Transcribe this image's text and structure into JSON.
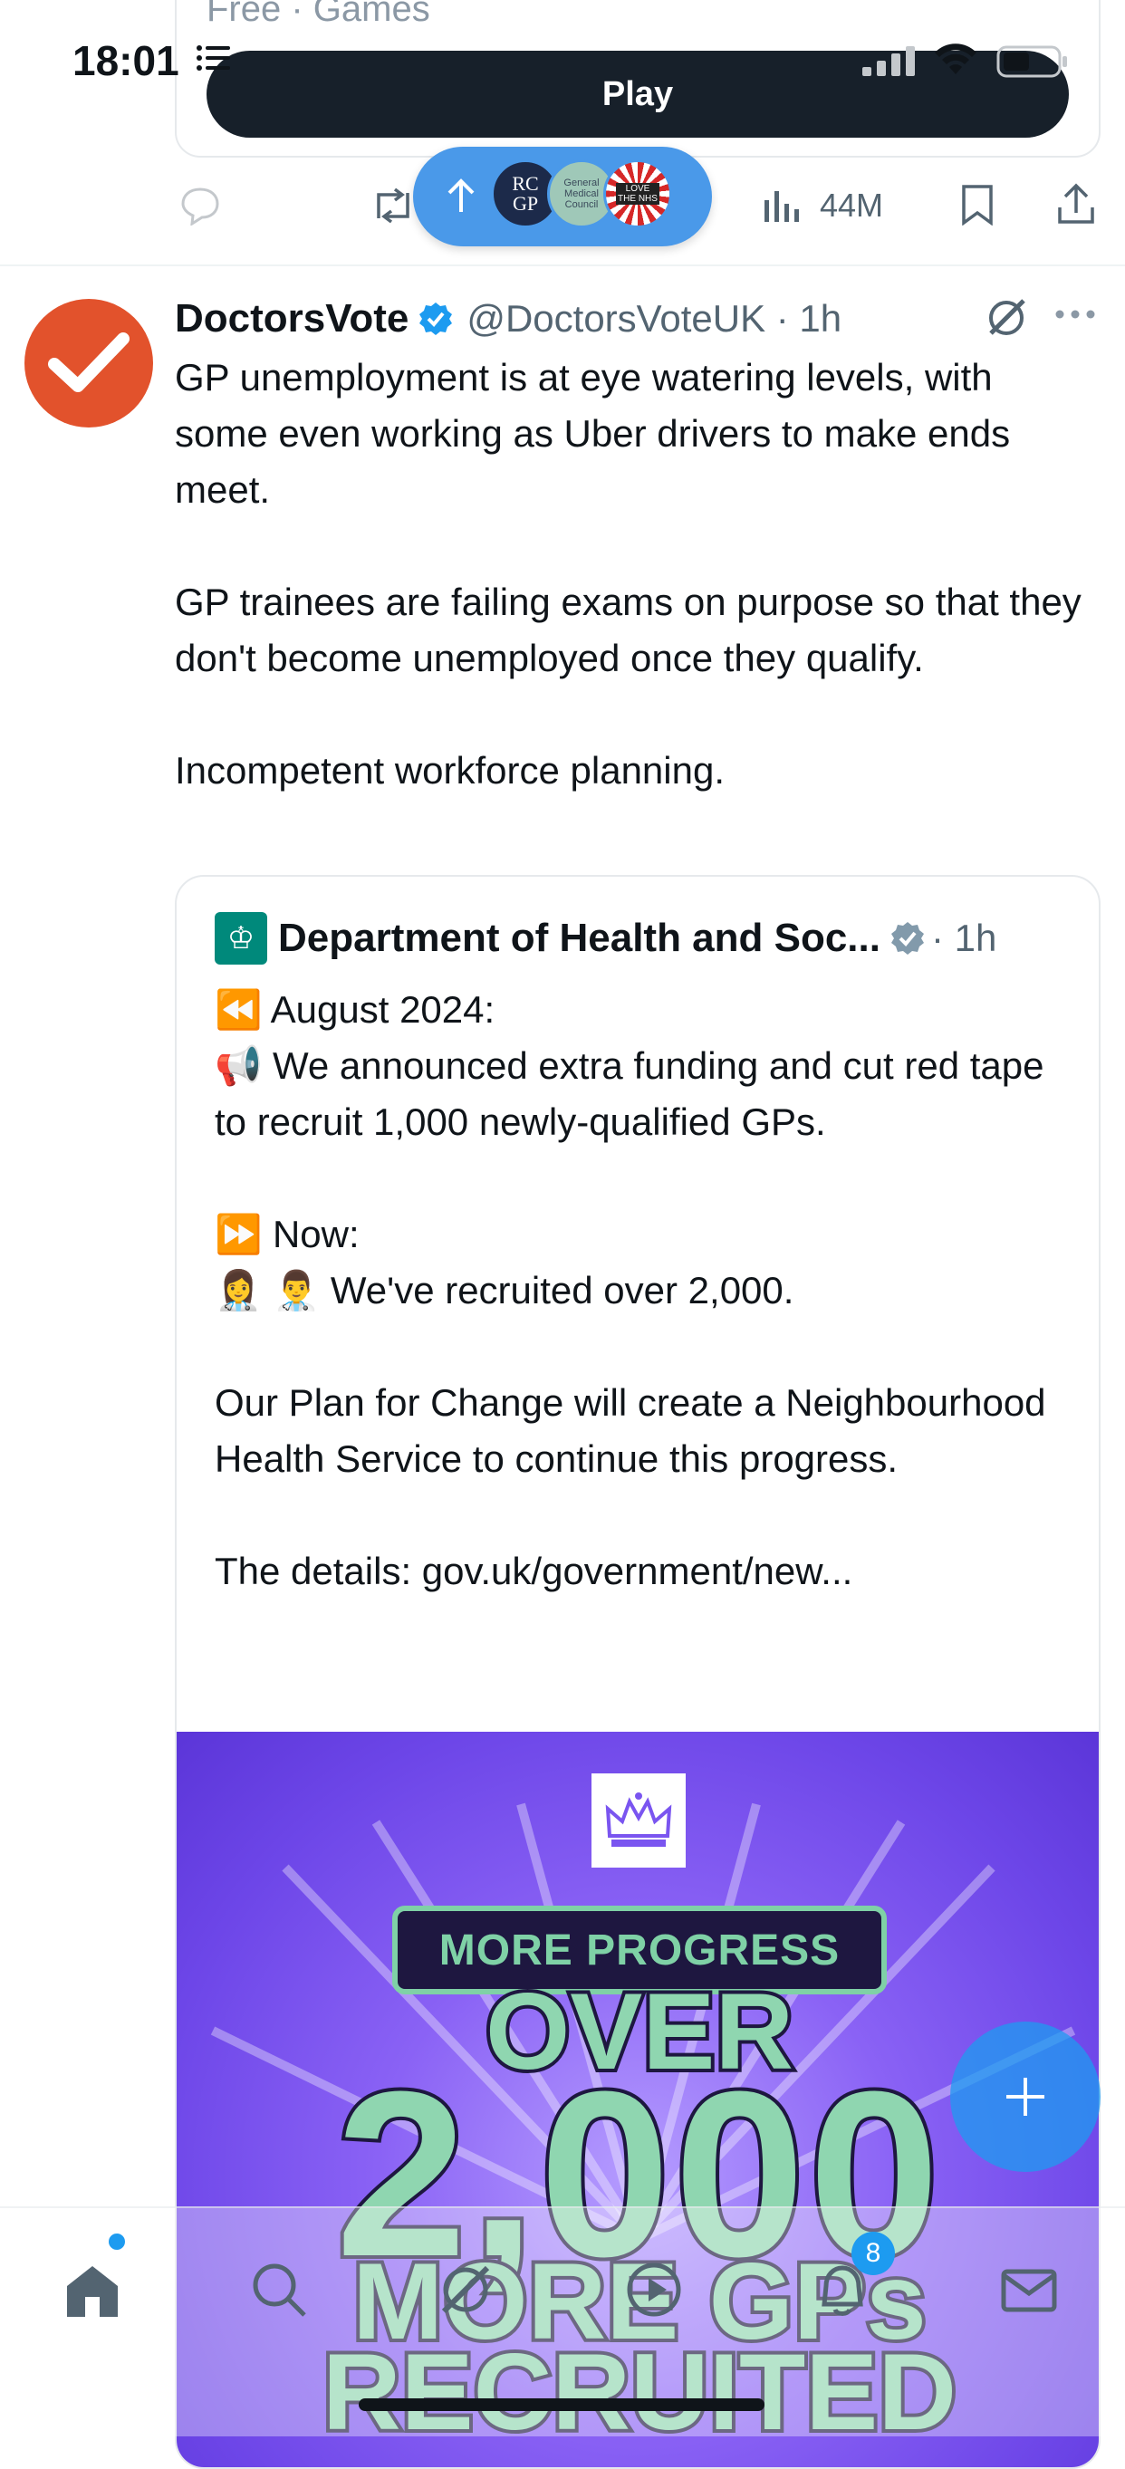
{
  "status_bar": {
    "time": "18:01"
  },
  "top_card": {
    "subtitle": "Free · Games",
    "play_label": "Play"
  },
  "previous_tweet_actions": {
    "views": "44M"
  },
  "new_posts_pill": {
    "avatars": [
      "RC GP",
      "General Medical Council",
      "LOVE THE NHS"
    ]
  },
  "tweet": {
    "author_name": "DoctorsVote",
    "handle_time": "@DoctorsVoteUK · 1h",
    "text": "GP unemployment is at eye watering levels, with some even working as Uber drivers to make ends meet.\n\nGP trainees are failing exams on purpose so that they don't become unemployed once they qualify.\n\nIncompetent workforce planning."
  },
  "quote": {
    "author_name": "Department of Health and Soc...",
    "time": "· 1h",
    "text": "⏪ August 2024:\n📢 We announced extra funding and cut red tape to recruit 1,000 newly-qualified GPs.\n\n⏩ Now:\n👩‍⚕️ 👨‍⚕️ We've recruited over 2,000.\n\nOur Plan for Change will create a Neighbourhood Health Service to continue this progress.\n\nThe details: gov.uk/government/new...",
    "image": {
      "banner": "MORE PROGRESS",
      "line1": "OVER",
      "line2": "2,000",
      "line3": "MORE GPs",
      "line4": "RECRUITED"
    }
  },
  "bottom_nav": {
    "notifications_count": "8"
  },
  "colors": {
    "accent": "#1d9bf0",
    "avatar_orange": "#e2522c",
    "image_purple": "#7a55f0",
    "image_green": "#8fd6b0"
  }
}
